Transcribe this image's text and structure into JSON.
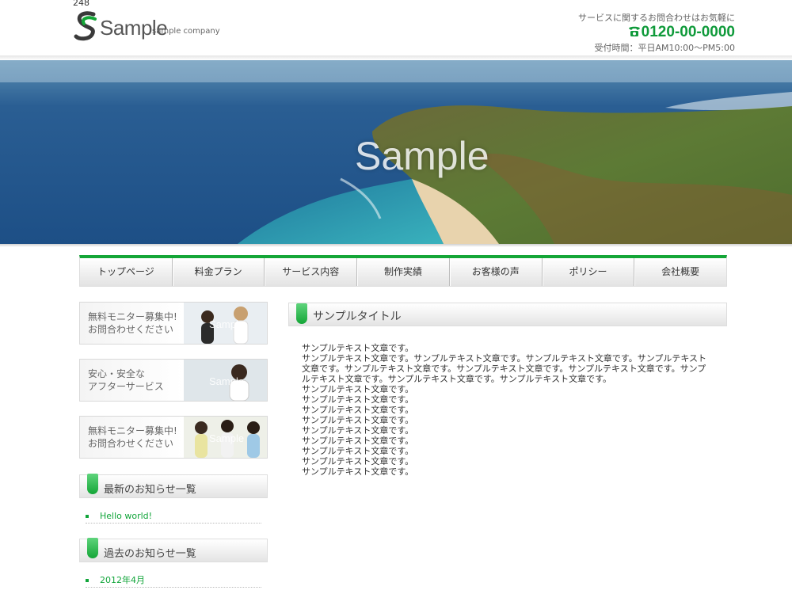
{
  "page_counter": "248",
  "logo": {
    "word": "Sample",
    "sub": "sample company"
  },
  "contact": {
    "lead": "サービスに関するお問合わせはお気軽に",
    "phone": "0120-00-0000",
    "hours": "受付時間：平日AM10:00～PM5:00"
  },
  "hero": {
    "caption": "Sample"
  },
  "nav": [
    "トップページ",
    "料金プラン",
    "サービス内容",
    "制作実績",
    "お客様の声",
    "ポリシー",
    "会社概要"
  ],
  "banners": [
    {
      "line1": "無料モニター募集中!",
      "line2": "お問合わせください",
      "img_text": "Sample"
    },
    {
      "line1": "安心・安全な",
      "line2": "アフターサービス",
      "img_text": "Sample"
    },
    {
      "line1": "無料モニター募集中!",
      "line2": "お問合わせください",
      "img_text": "Sample"
    }
  ],
  "sidebar": {
    "latest_heading": "最新のお知らせ一覧",
    "latest_items": [
      "Hello world!"
    ],
    "archive_heading": "過去のお知らせ一覧",
    "archive_items": [
      "2012年4月"
    ]
  },
  "main": {
    "title": "サンプルタイトル",
    "paragraphs": [
      "サンプルテキスト文章です。",
      "サンプルテキスト文章です。サンプルテキスト文章です。サンプルテキスト文章です。サンプルテキスト文章です。サンプルテキスト文章です。サンプルテキスト文章です。サンプルテキスト文章です。サンプルテキスト文章です。サンプルテキスト文章です。サンプルテキスト文章です。",
      "サンプルテキスト文章です。",
      "サンプルテキスト文章です。",
      "サンプルテキスト文章です。",
      "サンプルテキスト文章です。",
      "サンプルテキスト文章です。",
      "サンプルテキスト文章です。",
      "サンプルテキスト文章です。",
      "サンプルテキスト文章です。",
      "サンプルテキスト文章です。"
    ]
  },
  "colors": {
    "accent_green": "#14a637",
    "link_green": "#11a53a"
  }
}
